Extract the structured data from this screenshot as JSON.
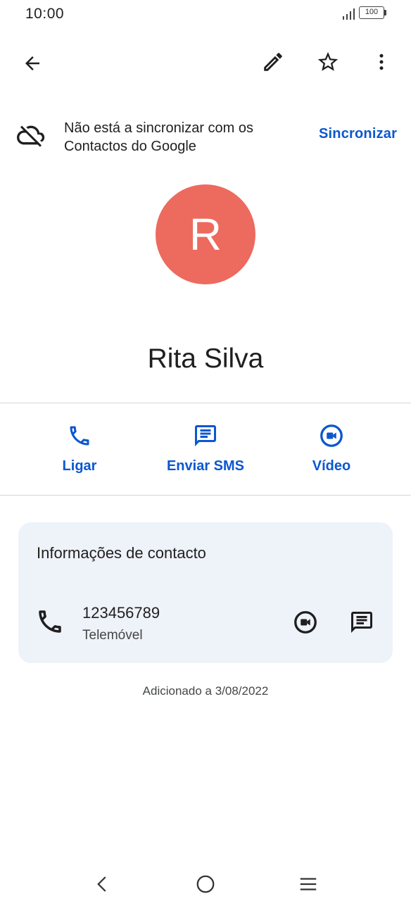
{
  "status_bar": {
    "time": "10:00",
    "battery": "100",
    "icons": [
      "signal-icon",
      "battery-icon"
    ]
  },
  "app_bar": {
    "icons": [
      "back-arrow-icon",
      "edit-pencil-icon",
      "star-outline-icon",
      "more-vert-icon"
    ]
  },
  "sync_banner": {
    "icon": "cloud-off-icon",
    "message": "Não está a sincronizar com os Contactos do Google",
    "action_label": "Sincronizar"
  },
  "contact": {
    "initial": "R",
    "name": "Rita Silva",
    "avatar_color": "#ed6a5e"
  },
  "actions": [
    {
      "label": "Ligar",
      "icon": "phone-icon"
    },
    {
      "label": "Enviar SMS",
      "icon": "message-icon"
    },
    {
      "label": "Vídeo",
      "icon": "video-call-icon"
    }
  ],
  "info_card": {
    "title": "Informações de contacto",
    "phone": {
      "number": "123456789",
      "type": "Telemóvel",
      "icons": [
        "phone-icon",
        "video-call-icon",
        "message-icon"
      ]
    }
  },
  "added_text": "Adicionado a 3/08/2022",
  "nav_bar": {
    "icons": [
      "nav-back-icon",
      "nav-home-icon",
      "nav-menu-icon"
    ]
  },
  "colors": {
    "accent": "#0b57d0",
    "card_bg": "#eef2f9",
    "text": "#1f1f1f"
  }
}
